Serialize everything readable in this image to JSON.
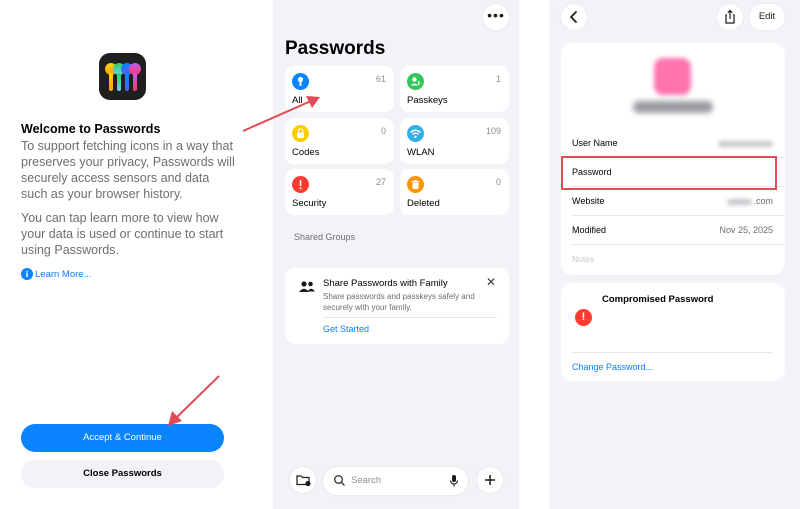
{
  "colors": {
    "accent": "#0a84ff",
    "annotation_red": "#e24a55",
    "background_grouped": "#f2f2f7",
    "alert_red": "#ff3b30"
  },
  "onboarding": {
    "title": "Welcome to Passwords",
    "paragraph1": "To support fetching icons in a way that preserves your privacy, Passwords will securely access sensors and data such as your browser history.",
    "paragraph2": "You can tap learn more to view how your data is used or continue to start using Passwords.",
    "learn_more": "Learn More...",
    "accept_button": "Accept & Continue",
    "close_button": "Close Passwords",
    "icons": {
      "app": "passwords-app-icon",
      "info": "info-icon"
    }
  },
  "passwords_home": {
    "more_icon": "ellipsis-icon",
    "title": "Passwords",
    "categories": [
      {
        "label": "All",
        "count": "61",
        "icon": "key-icon",
        "color": "#0a84ff"
      },
      {
        "label": "Passkeys",
        "count": "1",
        "icon": "person-key-icon",
        "color": "#34c759"
      },
      {
        "label": "Codes",
        "count": "0",
        "icon": "lock-code-icon",
        "color": "#ffcc00"
      },
      {
        "label": "WLAN",
        "count": "109",
        "icon": "wifi-icon",
        "color": "#32ade6"
      },
      {
        "label": "Security",
        "count": "27",
        "icon": "exclamation-icon",
        "color": "#ff3b30"
      },
      {
        "label": "Deleted",
        "count": "0",
        "icon": "trash-icon",
        "color": "#ff9500"
      }
    ],
    "shared_groups_header": "Shared Groups",
    "family_card": {
      "title": "Share Passwords with Family",
      "description": "Share passwords and passkeys safely and securely with your family.",
      "link": "Get Started"
    },
    "search_placeholder": "Search"
  },
  "password_detail": {
    "edit_button": "Edit",
    "rows": [
      {
        "label": "User Name",
        "value": ""
      },
      {
        "label": "Password",
        "value": ""
      },
      {
        "label": "Website",
        "value": ".com"
      },
      {
        "label": "Modified",
        "value": "Nov 25, 2025"
      }
    ],
    "notes_placeholder": "Notes",
    "compromised_title": "Compromised Password",
    "change_password_link": "Change Password..."
  }
}
